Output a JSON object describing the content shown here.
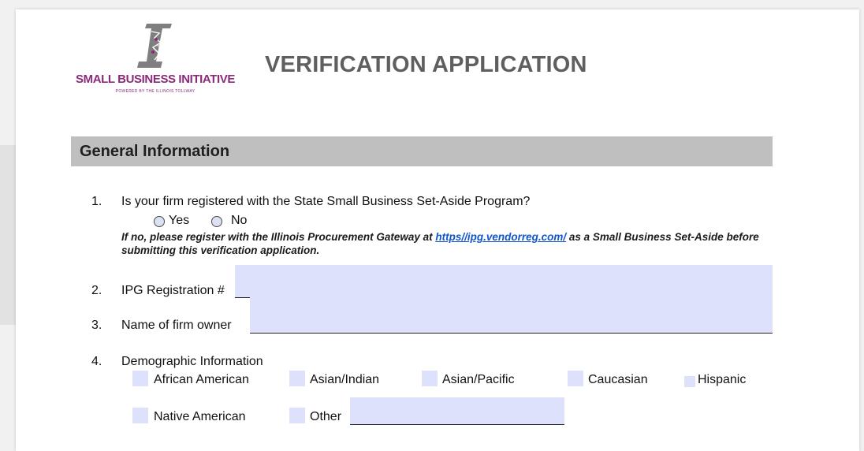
{
  "logo": {
    "name": "SMALL BUSINESS INITIATIVE",
    "tagline": "POWERED BY THE ILLINOIS TOLLWAY"
  },
  "title": "VERIFICATION APPLICATION",
  "section": "General Information",
  "q1": {
    "number": "1.",
    "question": "Is your firm registered with the State Small Business Set-Aside Program?",
    "options": [
      "Yes",
      "No"
    ],
    "note_before": "If no, please register with the Illinois Procurement Gateway at ",
    "note_link": "https//ipg.vendorreg.com/",
    "note_after": " as a Small Business Set-Aside before submitting this verification application."
  },
  "q2": {
    "number": "2.",
    "label": "IPG Registration #",
    "value": ""
  },
  "q3": {
    "number": "3.",
    "label": "Name of firm owner",
    "value": ""
  },
  "q4": {
    "number": "4.",
    "label": "Demographic Information",
    "options": [
      "African American",
      "Asian/Indian",
      "Asian/Pacific",
      "Caucasian",
      "Hispanic",
      "Native American",
      "Other"
    ],
    "other_value": ""
  },
  "colors": {
    "field_fill": "#dde1fb",
    "section_bar": "#bfbfbf",
    "brand": "#8b2a7a",
    "link": "#1155cc"
  }
}
